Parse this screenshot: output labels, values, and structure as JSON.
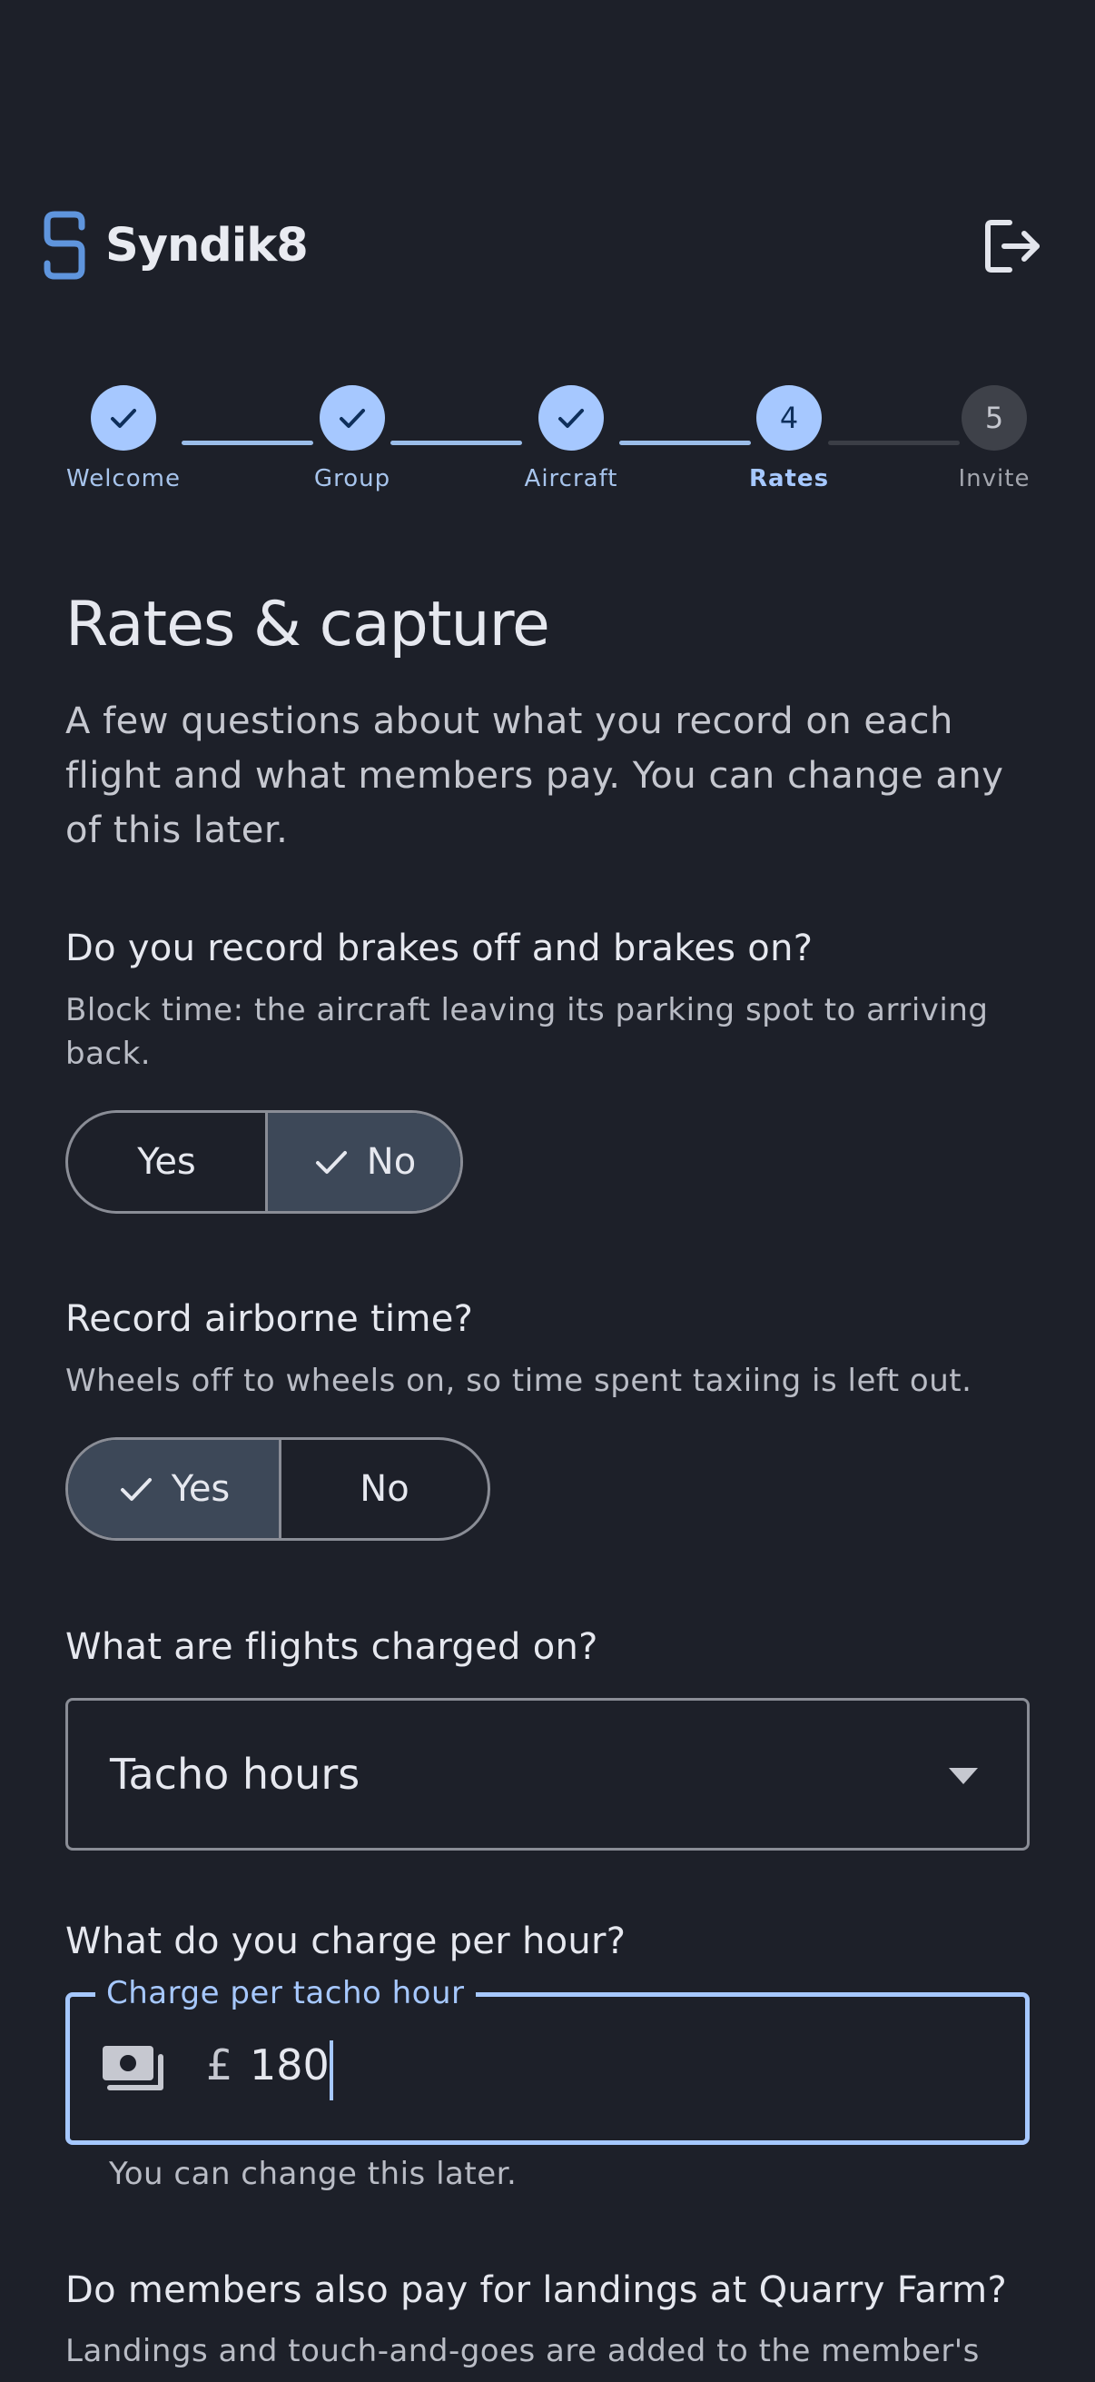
{
  "app": {
    "name": "Syndik8"
  },
  "colors": {
    "accent": "#a6c8ff",
    "background": "#1d2029",
    "selected_segment": "#3d4858"
  },
  "header": {
    "logout_icon": "logout-icon"
  },
  "stepper": {
    "steps": [
      {
        "label": "Welcome",
        "state": "done",
        "number": "1"
      },
      {
        "label": "Group",
        "state": "done",
        "number": "2"
      },
      {
        "label": "Aircraft",
        "state": "done",
        "number": "3"
      },
      {
        "label": "Rates",
        "state": "active",
        "number": "4"
      },
      {
        "label": "Invite",
        "state": "todo",
        "number": "5"
      }
    ]
  },
  "page": {
    "title": "Rates & capture",
    "intro": "A few questions about what you record on each flight and what members pay. You can change any of this later."
  },
  "questions": {
    "brakes": {
      "question": "Do you record brakes off and brakes on?",
      "help": "Block time: the aircraft leaving its parking spot to arriving back.",
      "options": [
        "Yes",
        "No"
      ],
      "selected": "No"
    },
    "airborne": {
      "question": "Record airborne time?",
      "help": "Wheels off to wheels on, so time spent taxiing is left out.",
      "options": [
        "Yes",
        "No"
      ],
      "selected": "Yes"
    },
    "charged_on": {
      "question": "What are flights charged on?",
      "selected_value": "Tacho hours"
    },
    "charge_per_hour": {
      "question": "What do you charge per hour?",
      "field_label": "Charge per tacho hour",
      "currency": "£",
      "value": "180",
      "supporting_text": "You can change this later."
    },
    "landings": {
      "question": "Do members also pay for landings at Quarry Farm?",
      "help": "Landings and touch-and-goes are added to the member's"
    }
  }
}
